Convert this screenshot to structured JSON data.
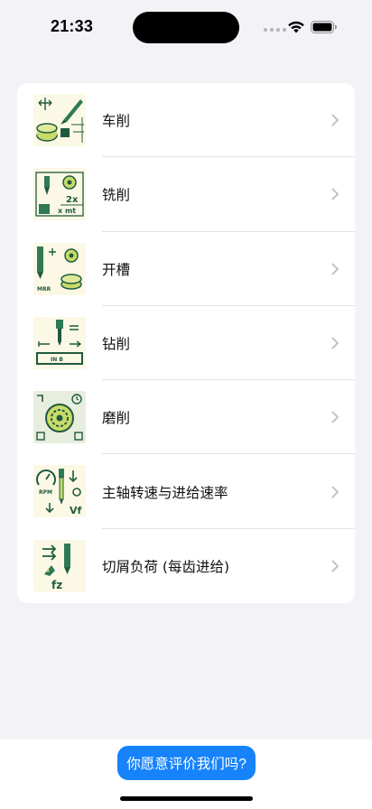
{
  "status_bar": {
    "time": "21:33"
  },
  "list": {
    "items": [
      {
        "label": "车削",
        "icon": "turning-icon"
      },
      {
        "label": "铣削",
        "icon": "milling-icon"
      },
      {
        "label": "开槽",
        "icon": "slotting-icon"
      },
      {
        "label": "钻削",
        "icon": "drilling-icon"
      },
      {
        "label": "磨削",
        "icon": "grinding-icon"
      },
      {
        "label": "主轴转速与进给速率",
        "icon": "spindle-speed-icon"
      },
      {
        "label": "切屑负荷 (每齿进给)",
        "icon": "chip-load-icon"
      }
    ]
  },
  "footer": {
    "rate_label": "你愿意评价我们吗?"
  },
  "colors": {
    "accent": "#1683fb",
    "background": "#f2f2f7",
    "icon_green": "#1f5a3e",
    "icon_bg": "#fbf9e6"
  },
  "icon_text": {
    "milling_formula_top": "2x",
    "milling_formula_bottom": "x mt",
    "slotting_caption": "MRR",
    "drilling_caption": "IN B",
    "spindle_caption": "RPM",
    "spindle_vf": "Vf",
    "chip_load": "fz"
  }
}
